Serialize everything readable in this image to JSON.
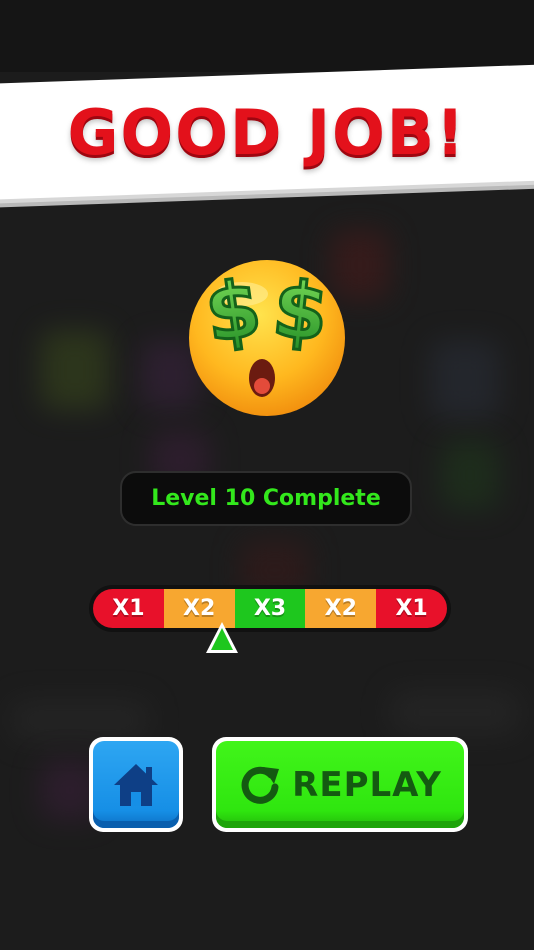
{
  "banner": {
    "title": "GOOD JOB!"
  },
  "emoji": {
    "name": "money-eyes-emoji-icon"
  },
  "level": {
    "label": "Level 10 Complete"
  },
  "multiplier": {
    "segments": [
      {
        "label": "X1",
        "color": "#e8112a"
      },
      {
        "label": "X2",
        "color": "#f7a730"
      },
      {
        "label": "X3",
        "color": "#1ec71e"
      },
      {
        "label": "X2",
        "color": "#f7a730"
      },
      {
        "label": "X1",
        "color": "#e8112a"
      }
    ],
    "pointer_color": "#1ec71e"
  },
  "buttons": {
    "home_icon": "home-icon",
    "replay_label": "REPLAY",
    "replay_icon": "refresh-icon"
  },
  "colors": {
    "banner_red": "#e3111b",
    "level_green": "#33e81c",
    "home_blue": "#168fe6",
    "replay_green": "#2fe60f",
    "replay_text": "#145a11"
  }
}
